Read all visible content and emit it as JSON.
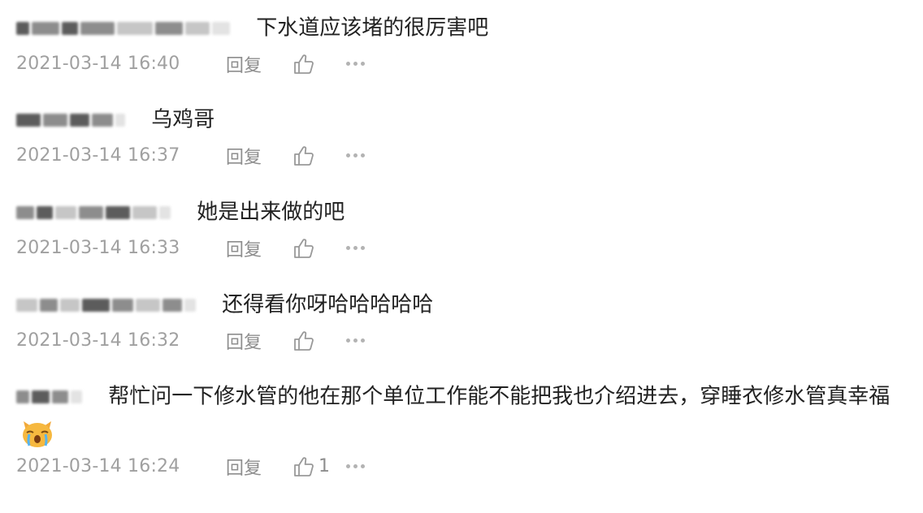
{
  "comments": [
    {
      "text": "下水道应该堵的很厉害吧",
      "time": "2021-03-14 16:40",
      "reply": "回复",
      "likes": ""
    },
    {
      "text": "乌鸡哥",
      "time": "2021-03-14 16:37",
      "reply": "回复",
      "likes": ""
    },
    {
      "text": "她是出来做的吧",
      "time": "2021-03-14 16:33",
      "reply": "回复",
      "likes": ""
    },
    {
      "text": "还得看你呀哈哈哈哈哈",
      "time": "2021-03-14 16:32",
      "reply": "回复",
      "likes": ""
    },
    {
      "text": "帮忙问一下修水管的他在那个单位工作能不能把我也介绍进去，穿睡衣修水管真幸福",
      "time": "2021-03-14 16:24",
      "reply": "回复",
      "likes": "1"
    }
  ],
  "icons": {
    "like": "thumbs-up-icon",
    "more": "more-dots-icon",
    "emoji": "crying-cat-emoji"
  },
  "colors": {
    "text": "#222222",
    "meta": "#a0a0a0",
    "emoji": "#f6b83f"
  }
}
